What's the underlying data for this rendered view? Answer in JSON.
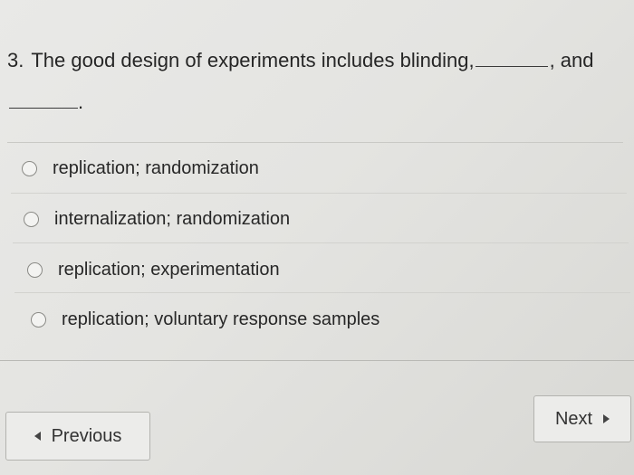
{
  "question": {
    "number": "3.",
    "text_before_blank": "The good design of experiments includes blinding,",
    "text_after_blank_1": ", and",
    "text_after_blank_2": "."
  },
  "options": [
    {
      "label": "replication; randomization",
      "selected": false
    },
    {
      "label": "internalization; randomization",
      "selected": false
    },
    {
      "label": "replication; experimentation",
      "selected": false
    },
    {
      "label": "replication; voluntary response samples",
      "selected": false
    }
  ],
  "navigation": {
    "previous_label": "Previous",
    "next_label": "Next"
  },
  "colors": {
    "background": "#e6e6e3",
    "text": "#262626",
    "radio_border": "#8a8a86",
    "button_border": "#b3b3af"
  },
  "icons": {
    "previous": "triangle-left-icon",
    "next": "triangle-right-icon"
  }
}
